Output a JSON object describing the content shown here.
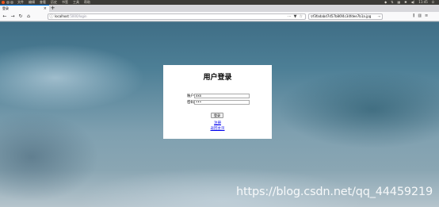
{
  "os_bar": {
    "menu": [
      "文件",
      "编辑",
      "查看",
      "历史",
      "书签",
      "工具",
      "帮助"
    ],
    "clock": "11:45"
  },
  "tab": {
    "title": "登录",
    "close": "×"
  },
  "new_tab": "+",
  "address_bar": {
    "host": "localhost",
    "path": ":5000/login",
    "more": "···"
  },
  "search_bar": {
    "value": "f3fadabd7d57b86f4c34fdee7b1a.jpg",
    "go": "→"
  },
  "login": {
    "title": "用户登录",
    "account_label": "账户",
    "account_value": "xxx",
    "password_label": "密码",
    "password_value": "•••",
    "submit_label": "登录",
    "register_link": "注册",
    "home_link": "返回主页"
  },
  "watermark": "https://blog.csdn.net/qq_44459219"
}
